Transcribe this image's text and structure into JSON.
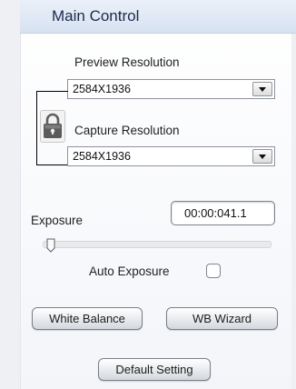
{
  "header": {
    "title": "Main Control"
  },
  "preview": {
    "label": "Preview Resolution",
    "value": "2584X1936"
  },
  "capture": {
    "label": "Capture Resolution",
    "value": "2584X1936"
  },
  "exposure": {
    "label": "Exposure",
    "time": "00:00:041.1",
    "slider_fraction": 0.0
  },
  "auto_exposure": {
    "label": "Auto Exposure",
    "checked": false
  },
  "buttons": {
    "white_balance": "White Balance",
    "wb_wizard": "WB Wizard",
    "default_setting": "Default Setting"
  },
  "icons": {
    "lock": "lock-icon",
    "dropdown": "chevron-down-icon",
    "collapse": "triangle-down-icon"
  }
}
